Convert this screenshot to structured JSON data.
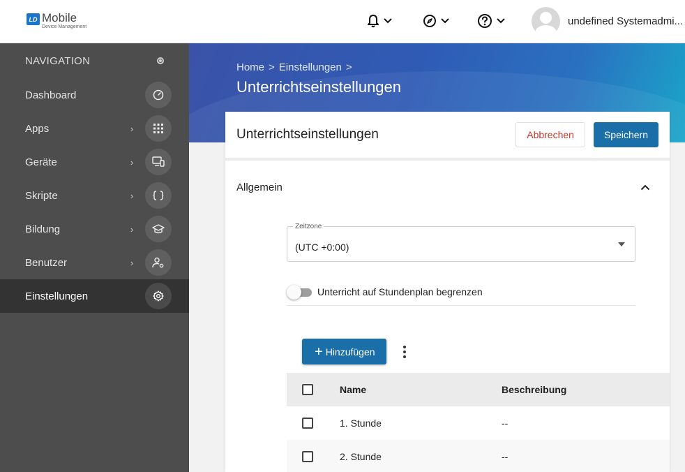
{
  "header": {
    "logo_mark": "LD",
    "logo_title": "Mobile",
    "logo_subtitle": "Device Management",
    "user_name": "undefined Systemadmi...",
    "user_chevron": "˅"
  },
  "sidebar": {
    "header": "NAVIGATION",
    "items": [
      {
        "label": "Dashboard",
        "arrow": "",
        "icon": "speedometer-icon"
      },
      {
        "label": "Apps",
        "arrow": "›",
        "icon": "grid-icon"
      },
      {
        "label": "Geräte",
        "arrow": "›",
        "icon": "devices-icon"
      },
      {
        "label": "Skripte",
        "arrow": "›",
        "icon": "braces-icon"
      },
      {
        "label": "Bildung",
        "arrow": "›",
        "icon": "graduation-cap-icon"
      },
      {
        "label": "Benutzer",
        "arrow": "›",
        "icon": "user-settings-icon"
      },
      {
        "label": "Einstellungen",
        "arrow": "",
        "icon": "gear-icon",
        "active": true
      }
    ]
  },
  "banner": {
    "breadcrumb": [
      "Home",
      ">",
      "Einstellungen",
      ">"
    ],
    "title": "Unterrichtseinstellungen"
  },
  "card": {
    "title": "Unterrichtseinstellungen",
    "cancel_label": "Abbrechen",
    "save_label": "Speichern",
    "section_title": "Allgemein",
    "timezone": {
      "label": "Zeitzone",
      "value": "(UTC +0:00)"
    },
    "toggle_label": "Unterricht auf Stundenplan begrenzen",
    "add_label": "Hinzufügen",
    "table": {
      "columns": [
        "Name",
        "Beschreibung"
      ],
      "rows": [
        {
          "name": "1. Stunde",
          "description": "--"
        },
        {
          "name": "2. Stunde",
          "description": "--"
        }
      ]
    }
  },
  "colors": {
    "primary": "#1a6fa8",
    "cancel_text": "#c0392b",
    "sidebar_bg": "#4d4d4d",
    "sidebar_active": "#333333"
  }
}
